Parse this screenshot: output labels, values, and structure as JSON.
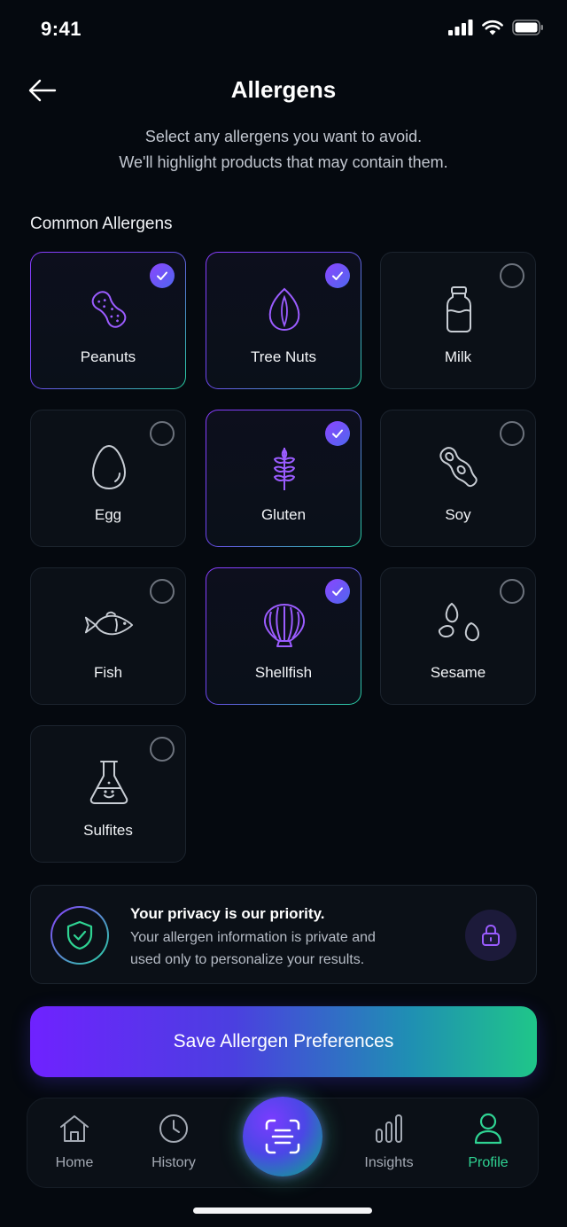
{
  "status_bar": {
    "time": "9:41"
  },
  "header": {
    "title": "Allergens",
    "subtitle_line1": "Select any allergens you want to avoid.",
    "subtitle_line2": "We'll highlight products that may contain them."
  },
  "section": {
    "title": "Common Allergens"
  },
  "allergens": [
    {
      "label": "Peanuts",
      "icon": "peanut-icon",
      "selected": true
    },
    {
      "label": "Tree Nuts",
      "icon": "almond-icon",
      "selected": true
    },
    {
      "label": "Milk",
      "icon": "milk-bottle-icon",
      "selected": false
    },
    {
      "label": "Egg",
      "icon": "egg-icon",
      "selected": false
    },
    {
      "label": "Gluten",
      "icon": "wheat-icon",
      "selected": true
    },
    {
      "label": "Soy",
      "icon": "soybean-icon",
      "selected": false
    },
    {
      "label": "Fish",
      "icon": "fish-icon",
      "selected": false
    },
    {
      "label": "Shellfish",
      "icon": "shell-icon",
      "selected": true
    },
    {
      "label": "Sesame",
      "icon": "sesame-seeds-icon",
      "selected": false
    },
    {
      "label": "Sulfites",
      "icon": "flask-icon",
      "selected": false
    }
  ],
  "privacy": {
    "title": "Your privacy is our priority.",
    "text_line1": "Your allergen information is private and",
    "text_line2": "used only to personalize your results."
  },
  "save_button": {
    "label": "Save Allergen Preferences"
  },
  "nav": {
    "items": [
      {
        "label": "Home",
        "icon": "home-icon"
      },
      {
        "label": "History",
        "icon": "clock-icon"
      },
      {
        "label": "Insights",
        "icon": "bar-chart-icon"
      },
      {
        "label": "Profile",
        "icon": "user-icon",
        "active": true
      }
    ],
    "scan_icon": "scan-icon"
  },
  "colors": {
    "background": "#05090f",
    "accent_purple": "#8a3dff",
    "accent_green": "#2fd493",
    "icon_selected": "#9b5cff",
    "icon_default": "#c8cdd4"
  }
}
